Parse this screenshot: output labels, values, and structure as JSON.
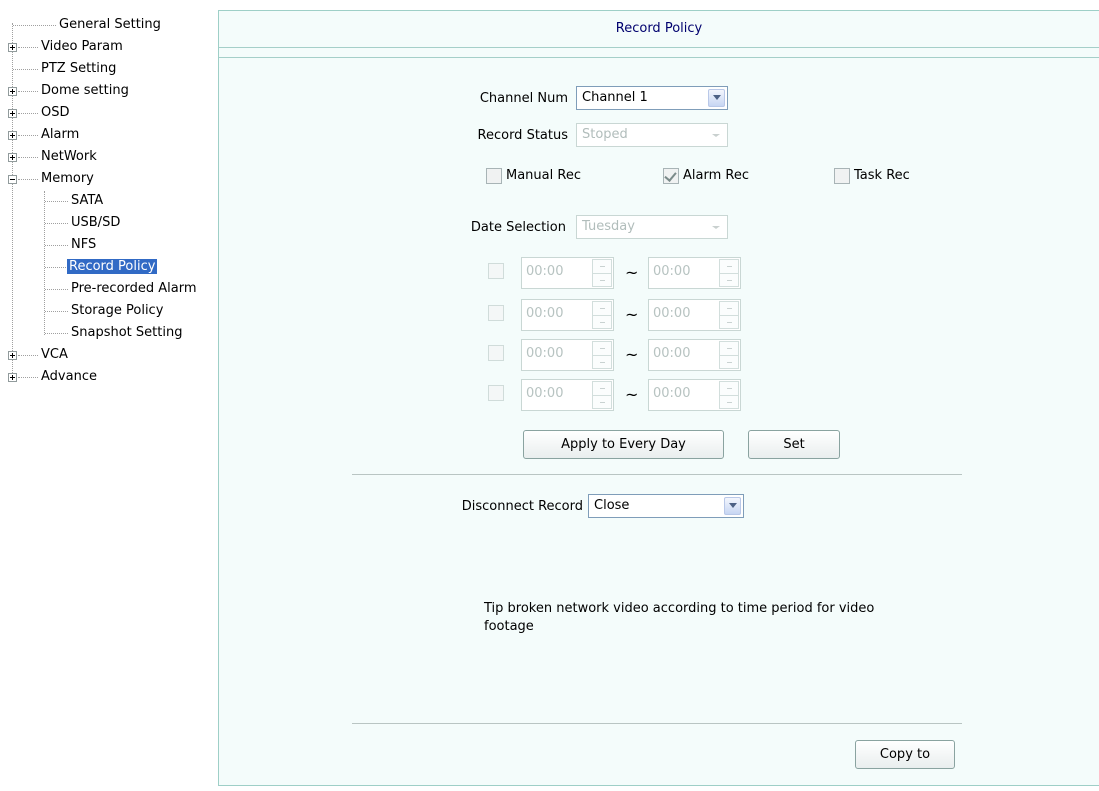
{
  "tree": {
    "items": [
      {
        "label": "General Setting"
      },
      {
        "label": "Video Param"
      },
      {
        "label": "PTZ Setting"
      },
      {
        "label": "Dome setting"
      },
      {
        "label": "OSD"
      },
      {
        "label": "Alarm"
      },
      {
        "label": "NetWork"
      },
      {
        "label": "Memory"
      },
      {
        "label": "SATA"
      },
      {
        "label": "USB/SD"
      },
      {
        "label": "NFS"
      },
      {
        "label": "Record Policy"
      },
      {
        "label": "Pre-recorded Alarm"
      },
      {
        "label": "Storage Policy"
      },
      {
        "label": "Snapshot Setting"
      },
      {
        "label": "VCA"
      },
      {
        "label": "Advance"
      }
    ]
  },
  "panel": {
    "title": "Record Policy",
    "channel_label": "Channel Num",
    "channel_value": "Channel  1",
    "status_label": "Record Status",
    "status_value": "Stoped",
    "manual_rec": "Manual Rec",
    "alarm_rec": "Alarm Rec",
    "task_rec": "Task Rec",
    "date_label": "Date Selection",
    "date_value": "Tuesday",
    "periods": [
      {
        "start": "00:00",
        "end": "00:00"
      },
      {
        "start": "00:00",
        "end": "00:00"
      },
      {
        "start": "00:00",
        "end": "00:00"
      },
      {
        "start": "00:00",
        "end": "00:00"
      }
    ],
    "tilde": "~",
    "apply_every_day": "Apply to Every Day",
    "set": "Set",
    "disconnect_label": "Disconnect Record",
    "disconnect_value": "Close",
    "tip": "Tip broken network video according to time period for video footage",
    "copy_to": "Copy to"
  },
  "colors": {
    "panel_bg": "#f4fcfb",
    "title_text": "#00006e",
    "selection": "#316ac5"
  }
}
